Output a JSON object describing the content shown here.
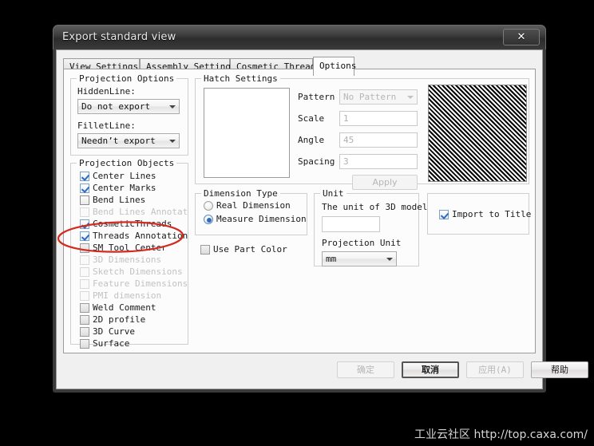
{
  "window": {
    "title": "Export standard view",
    "close_label": "✕"
  },
  "tabs": [
    {
      "label": "View Settings",
      "active": false
    },
    {
      "label": "Assembly Settings",
      "active": false
    },
    {
      "label": "Cosmetic Thread",
      "active": false
    },
    {
      "label": "Options",
      "active": true
    }
  ],
  "projection_options": {
    "group_label": "Projection Options",
    "hidden_line_label": "HiddenLine:",
    "hidden_line_value": "Do not export",
    "fillet_line_label": "FilletLine:",
    "fillet_line_value": "Needn’t export"
  },
  "projection_objects": {
    "group_label": "Projection Objects",
    "items": [
      {
        "label": "Center Lines",
        "checked": true,
        "enabled": true
      },
      {
        "label": "Center Marks",
        "checked": true,
        "enabled": true
      },
      {
        "label": "Bend Lines",
        "checked": false,
        "enabled": true
      },
      {
        "label": "Bend Lines Annotat",
        "checked": false,
        "enabled": false
      },
      {
        "label": "CosmeticThreads",
        "checked": true,
        "enabled": true
      },
      {
        "label": "Threads Annotation",
        "checked": true,
        "enabled": true
      },
      {
        "label": "SM Tool Center",
        "checked": false,
        "enabled": true
      },
      {
        "label": "3D Dimensions",
        "checked": false,
        "enabled": false
      },
      {
        "label": "Sketch Dimensions",
        "checked": false,
        "enabled": false
      },
      {
        "label": "Feature Dimensions",
        "checked": false,
        "enabled": false
      },
      {
        "label": "PMI dimension",
        "checked": false,
        "enabled": false
      },
      {
        "label": "Weld Comment",
        "checked": false,
        "enabled": true
      },
      {
        "label": "2D profile",
        "checked": false,
        "enabled": true
      },
      {
        "label": "3D Curve",
        "checked": false,
        "enabled": true
      },
      {
        "label": "Surface",
        "checked": false,
        "enabled": true
      }
    ]
  },
  "hatch_settings": {
    "group_label": "Hatch Settings",
    "pattern_label": "Pattern",
    "pattern_value": "No Pattern",
    "scale_label": "Scale",
    "scale_value": "1",
    "angle_label": "Angle",
    "angle_value": "45",
    "spacing_label": "Spacing",
    "spacing_value": "3",
    "apply_label": "Apply",
    "preview_angle_deg": 45
  },
  "dimension_type": {
    "group_label": "Dimension Type",
    "options": [
      {
        "label": "Real Dimension",
        "selected": false
      },
      {
        "label": "Measure Dimension",
        "selected": true
      }
    ],
    "use_part_color_label": "Use Part Color",
    "use_part_color_checked": false
  },
  "unit": {
    "group_label": "Unit",
    "model_unit_label": "The unit of 3D model",
    "model_unit_value": "",
    "projection_unit_label": "Projection Unit",
    "projection_unit_value": "mm"
  },
  "title_block": {
    "import_to_title_label": "Import to Title",
    "import_to_title_checked": true
  },
  "footer_buttons": [
    {
      "label": "确定",
      "state": "disabled"
    },
    {
      "label": "取消",
      "state": "default"
    },
    {
      "label": "应用(A)",
      "state": "disabled"
    },
    {
      "label": "帮助",
      "state": "normal"
    }
  ],
  "annotation": {
    "shape": "red-ellipse",
    "color": "#d42b20",
    "targets": [
      "CosmeticThreads",
      "Threads Annotation"
    ]
  },
  "watermark": {
    "text": "工业云社区 http://top.caxa.com/"
  }
}
